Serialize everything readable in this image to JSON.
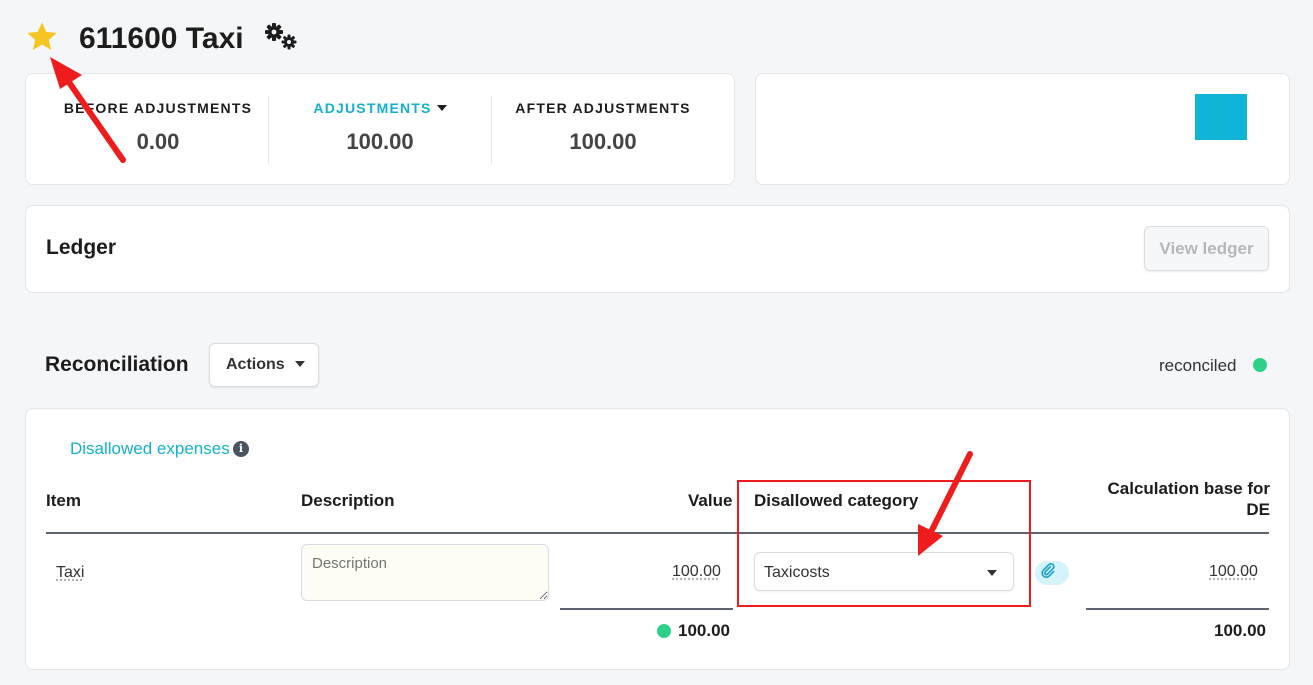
{
  "header": {
    "title": "611600 Taxi",
    "favorite_icon": "star-icon",
    "settings_icon": "gears-icon"
  },
  "summary": {
    "before": {
      "label": "BEFORE ADJUSTMENTS",
      "value": "0.00"
    },
    "adjustments": {
      "label": "ADJUSTMENTS",
      "value": "100.00"
    },
    "after": {
      "label": "AFTER ADJUSTMENTS",
      "value": "100.00"
    }
  },
  "ledger": {
    "title": "Ledger",
    "view_button": "View ledger"
  },
  "reconciliation": {
    "title": "Reconciliation",
    "actions_button": "Actions",
    "status": "reconciled",
    "status_color": "#2fd08a",
    "section_link": "Disallowed expenses",
    "info_glyph": "i",
    "columns": {
      "item": "Item",
      "description": "Description",
      "value": "Value",
      "category": "Disallowed category",
      "calc_base": "Calculation base for DE"
    },
    "row": {
      "item": "Taxi",
      "description_placeholder": "Description",
      "value": "100.00",
      "category": "Taxicosts",
      "calc_base": "100.00"
    },
    "totals": {
      "value": "100.00",
      "calc_base": "100.00"
    }
  },
  "colors": {
    "accent": "#15b0cf",
    "star": "#f6c523",
    "annotation": "#ee1c1c"
  }
}
